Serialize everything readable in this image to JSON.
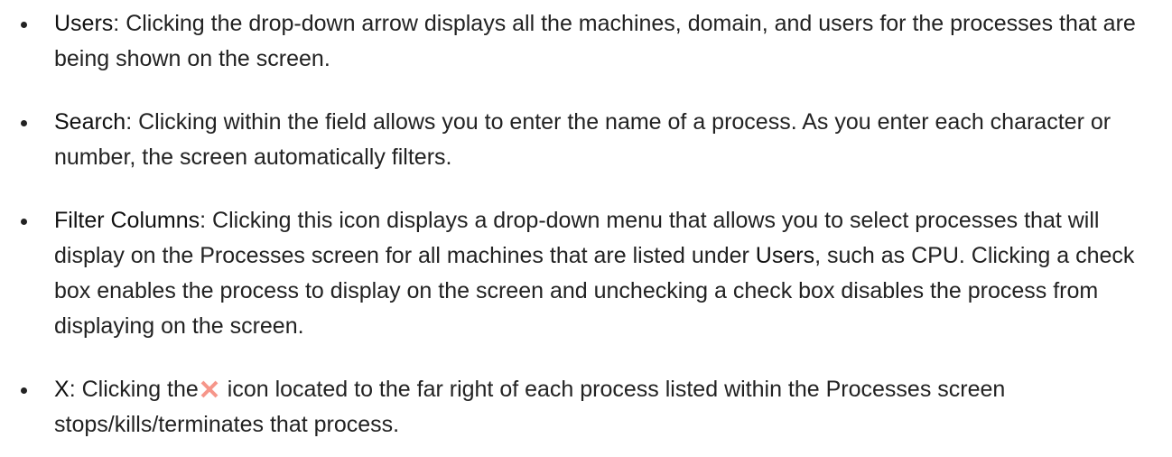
{
  "items": [
    {
      "term": "Users",
      "text": ": Clicking the drop-down arrow displays all the machines, domain, and users for the processes that are being shown on the screen."
    },
    {
      "term": "Search",
      "text": ": Clicking within the field allows you to enter the name of a process. As you enter each character or number, the screen automatically filters."
    },
    {
      "term": "Filter Columns",
      "text_before": ": Clicking this icon displays a drop-down menu that allows you to select processes that will display on the Processes screen for all machines that are listed under ",
      "inline_term": "Users",
      "text_after": ", such as CPU. Clicking a check box enables the process to display on the screen and unchecking a check box disables the process from displaying on the screen."
    },
    {
      "term": "X",
      "text_before": ": Clicking the",
      "icon": "close-x-icon",
      "text_after": " icon located to the far right of each process listed within the Processes screen stops/kills/terminates that process."
    }
  ],
  "colors": {
    "text": "#222222",
    "x_icon": "#f6968a"
  }
}
